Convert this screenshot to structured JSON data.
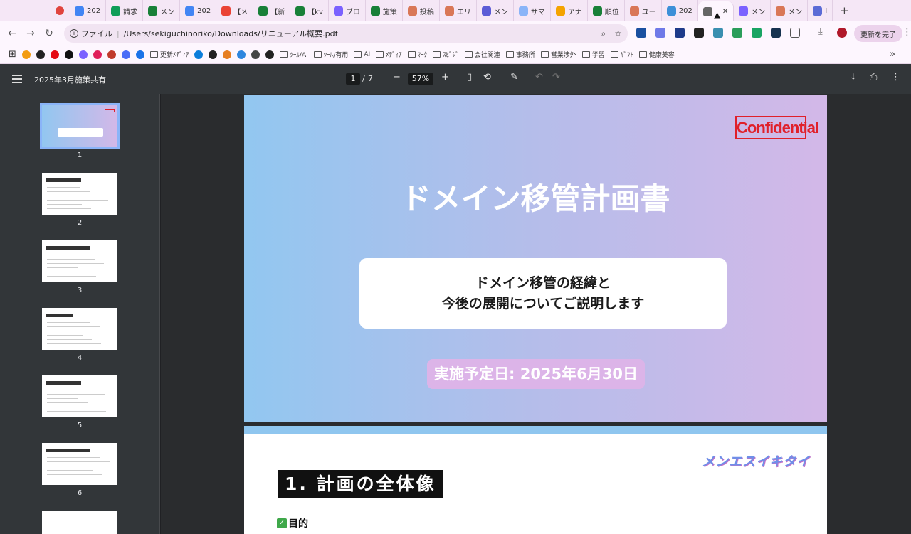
{
  "tabs": [
    {
      "label": "202",
      "color": "#4285f4"
    },
    {
      "label": "請求",
      "color": "#0f9d58"
    },
    {
      "label": "メン",
      "color": "#188038"
    },
    {
      "label": "202",
      "color": "#4285f4"
    },
    {
      "label": "【メ",
      "color": "#ea4335"
    },
    {
      "label": "【新",
      "color": "#188038"
    },
    {
      "label": "【kv",
      "color": "#188038"
    },
    {
      "label": "ブロ",
      "color": "#7b61ff"
    },
    {
      "label": "施策",
      "color": "#188038"
    },
    {
      "label": "投稿",
      "color": "#d97757"
    },
    {
      "label": "エリ",
      "color": "#d97757"
    },
    {
      "label": "メン",
      "color": "#5b5bd6"
    },
    {
      "label": "サマ",
      "color": "#8ab4f8"
    },
    {
      "label": "アナ",
      "color": "#f4a300"
    },
    {
      "label": "順位",
      "color": "#188038"
    },
    {
      "label": "ユー",
      "color": "#d97757"
    },
    {
      "label": "202",
      "color": "#3c8fd8"
    },
    {
      "label": "",
      "color": "#666",
      "active": true
    },
    {
      "label": "メン",
      "color": "#7b61ff"
    },
    {
      "label": "メン",
      "color": "#d97757"
    },
    {
      "label": "I",
      "color": "#5b6bd6"
    }
  ],
  "address": {
    "scheme_label": "ファイル",
    "url": "/Users/sekiguchinoriko/Downloads/リニューアル概要.pdf"
  },
  "update_button": "更新を完了",
  "bookmarks": [
    "更新ﾒﾃﾞｨｱ",
    "ﾂｰﾙ/AI",
    "ﾂｰﾙ/有用",
    "AI",
    "ﾒﾃﾞｨｱ",
    "ﾏｰｸ",
    "ｽﾋﾟｼﾞ",
    "会社関連",
    "事務所",
    "営業渉外",
    "学習",
    "ｷﾞﾌﾄ",
    "健康美容"
  ],
  "pdf": {
    "title": "2025年3月施策共有",
    "current_page": "1",
    "total_pages": "7",
    "zoom": "57%",
    "thumbnails": [
      "1",
      "2",
      "3",
      "4",
      "5",
      "6"
    ],
    "page1": {
      "confidential": "Confidential",
      "title": "ドメイン移管計画書",
      "subtitle_line1": "ドメイン移管の経緯と",
      "subtitle_line2": "今後の展開についてご説明します",
      "date": "実施予定日: 2025年6月30日"
    },
    "page2": {
      "brand": "メンエスイキタイ",
      "section_title": "1. 計画の全体像",
      "purpose_label": "目的"
    }
  },
  "colors": {
    "tabbar": "#f5e7f6",
    "pdf_toolbar": "#323639",
    "confidential": "#e0202a",
    "selected_thumb": "#8ab4f8"
  }
}
